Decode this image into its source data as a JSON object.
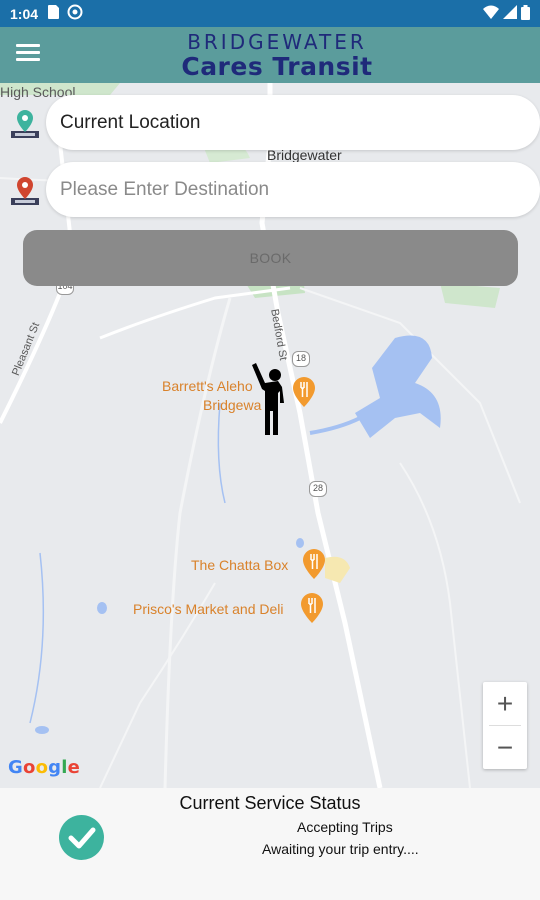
{
  "status_bar": {
    "time": "1:04"
  },
  "app_bar": {
    "brand_top": "BRIDGEWATER",
    "brand_bottom": "Cares Transit",
    "menu_icon": "hamburger-menu-icon"
  },
  "map": {
    "labels": {
      "high_school": "High School",
      "bridgewater": "Bridgewater",
      "bedford_st": "Bedford St",
      "pleasant_st": "Pleasant St"
    },
    "route_shields": {
      "r104": "104",
      "r18": "18",
      "r28": "28"
    },
    "pois": {
      "barretts": "Barrett's Aleho",
      "barretts_line2": "Bridgewa",
      "chatta": "The Chatta Box",
      "prisco": "Prisco's Market and Deli"
    },
    "google": "Google"
  },
  "search": {
    "origin_value": "Current Location",
    "destination_placeholder": "Please Enter Destination",
    "book_label": "BOOK"
  },
  "zoom": {
    "in": "+",
    "out": "−"
  },
  "service_status": {
    "title": "Current Service Status",
    "line1": "Accepting Trips",
    "line2": "Awaiting your trip entry...."
  },
  "colors": {
    "status_bar": "#1b6fa8",
    "app_bar": "#5b9c9c",
    "brand": "#1f2a7a",
    "poi": "#d9822b",
    "check": "#3db39e"
  }
}
